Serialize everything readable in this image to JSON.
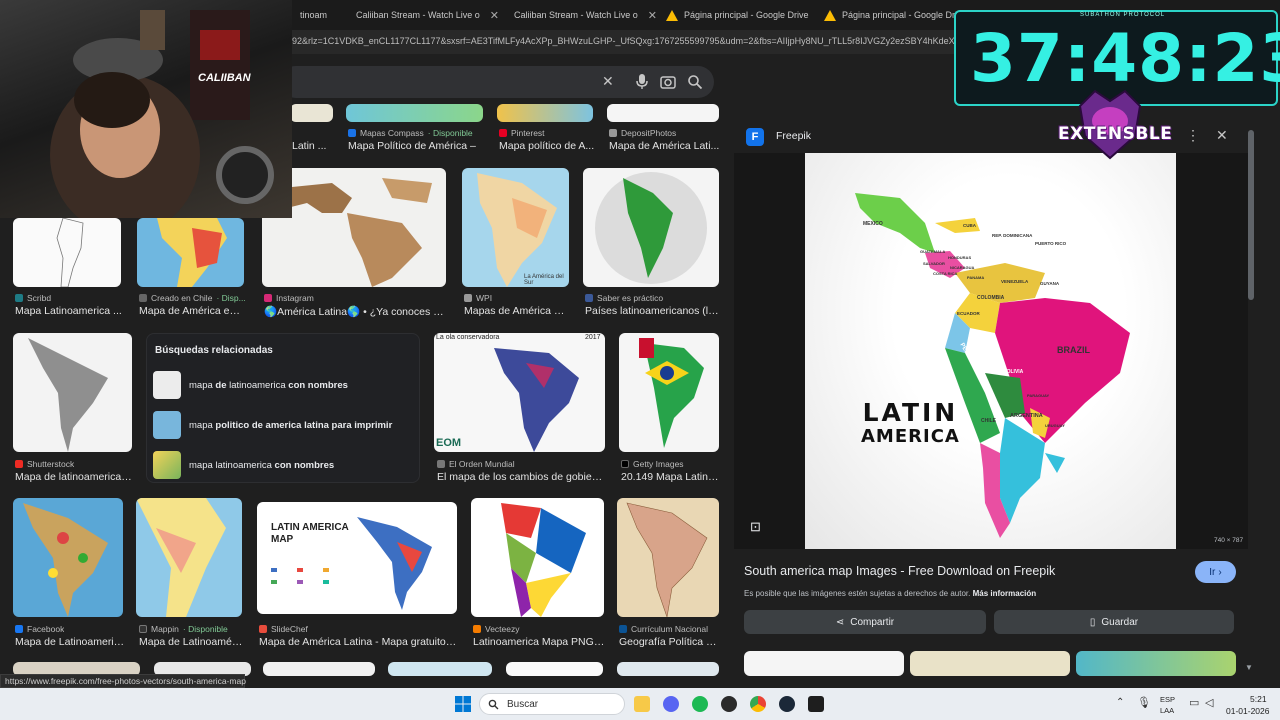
{
  "browser": {
    "tabs": [
      {
        "label": "tinoam",
        "type": "partial"
      },
      {
        "label": "Caliiban Stream - Watch Live o",
        "type": "kick"
      },
      {
        "label": "Caliiban Stream - Watch Live o",
        "type": "kick"
      },
      {
        "label": "Página principal - Google Drive",
        "type": "gdrive"
      },
      {
        "label": "Página principal - Google Drive",
        "type": "gdrive"
      }
    ],
    "url": "92&rlz=1C1VDKB_enCL1177CL1177&sxsrf=AE3TifMLFy4AcXPp_BHWzuLGHP-_UfSQxg:1767255599795&udm=2&fbs=AIIjpHy8NU_rTLL5r8IJVGZy2ezSBY4hKdeX"
  },
  "results": {
    "row1": [
      {
        "source": "Mapas Compass",
        "available": "· Disponible",
        "title": "Mapa Político de América –",
        "fav": "#1a73e8"
      },
      {
        "source": "Pinterest",
        "available": "",
        "title": "Mapa político de A...",
        "fav": "#e60023"
      },
      {
        "source": "DepositPhotos",
        "available": "",
        "title": "Mapa de América Lati...",
        "fav": "#222"
      },
      {
        "source": "",
        "available": "",
        "title": "Latin ...",
        "fav": "#555"
      }
    ],
    "row2": [
      {
        "source": "Scribd",
        "available": "",
        "title": "Mapa Latinoamerica ...",
        "fav": "#1e7b85"
      },
      {
        "source": "Creado en Chile",
        "available": "· Disp...",
        "title": "Mapa de América en ...",
        "fav": "#666"
      },
      {
        "source": "Instagram",
        "available": "",
        "title": "🌎América Latina🌎 • ¿Ya conoces nue...",
        "fav": "#d62976"
      },
      {
        "source": "WPI",
        "available": "",
        "title": "Mapas de América La...",
        "fav": "#999"
      },
      {
        "source": "Saber es práctico",
        "available": "",
        "title": "Países latinoamericanos (lis...",
        "fav": "#3b5998"
      }
    ],
    "row3": [
      {
        "source": "Shutterstock",
        "available": "",
        "title": "Mapa de latinoamerica: ...",
        "fav": "#ee2b24"
      },
      {
        "source": "El Orden Mundial",
        "available": "",
        "title": "El mapa de los cambios de gobierno...",
        "fav": "#777"
      },
      {
        "source": "Getty Images",
        "available": "",
        "title": "20.149 Mapa Latino...",
        "fav": "#000"
      }
    ],
    "row4": [
      {
        "source": "Facebook",
        "available": "",
        "title": "Mapa de Latinoameric...",
        "fav": "#1877f2"
      },
      {
        "source": "Mappin",
        "available": "· Disponible",
        "title": "Mapa de Latinoaméri...",
        "fav": "#333"
      },
      {
        "source": "SlideChef",
        "available": "",
        "title": "Mapa de América Latina - Mapa gratuito de ...",
        "fav": "#e74c3c"
      },
      {
        "source": "Vecteezy",
        "available": "",
        "title": "Latinoamerica Mapa PNG ...",
        "fav": "#f57c00"
      },
      {
        "source": "Currículum Nacional",
        "available": "",
        "title": "Geografía Política d...",
        "fav": "#0b5394"
      }
    ],
    "thumb_texts": {
      "ola": "La ola conservadora",
      "ola_year": "2017",
      "eom": "EOM",
      "latin_map_title": "LATIN AMERICA MAP",
      "sud": "La América del Sur"
    }
  },
  "related": {
    "header": "Búsquedas relacionadas",
    "items": [
      {
        "pre": "mapa ",
        "bold1": "de",
        "mid": " latinoamerica ",
        "bold2": "con nombres",
        "post": ""
      },
      {
        "pre": "mapa ",
        "bold1": "politico de america latina para imprimir",
        "mid": "",
        "bold2": "",
        "post": ""
      },
      {
        "pre": "mapa latinoamerica ",
        "bold1": "con nombres",
        "mid": "",
        "bold2": "",
        "post": ""
      }
    ]
  },
  "panel": {
    "site": "Freepik",
    "image_title": "LATIN AMERICA",
    "title_line1": "LATIN",
    "title_line2": "AMERICA",
    "dimensions": "740 × 787",
    "title": "South america map Images - Free Download on Freepik",
    "visit": "Ir",
    "copyright": "Es posible que las imágenes estén sujetas a derechos de autor.",
    "more_info": "Más información",
    "share": "Compartir",
    "save": "Guardar",
    "map_labels": {
      "mexico": "MEXICO",
      "cuba": "CUBA",
      "rep_dom": "REP. DOMINICANA",
      "puerto_rico": "PUERTO RICO",
      "guatemala": "GUATEMALA",
      "honduras": "HONDURAS",
      "salvador": "SALVADOR",
      "nicaragua": "NICARAGUA",
      "costa_rica": "COSTA RICA",
      "panama": "PANAMA",
      "venezuela": "VENEZUELA",
      "guyana": "GUYANA",
      "colombia": "COLOMBIA",
      "ecuador": "ECUADOR",
      "peru": "PERU",
      "brazil": "BRAZIL",
      "bolivia": "BOLIVIA",
      "paraguay": "PARAGUAY",
      "chile": "CHILE",
      "argentina": "ARGENTINA",
      "uruguay": "URUGUAY"
    }
  },
  "overlay": {
    "timer": "37:48:23",
    "timer_caption": "SUBATHON PROTOCOL",
    "badge": "EXTENSBLE",
    "webcam_sign": "CALIIBAN"
  },
  "statusbar": "https://www.freepik.com/free-photos-vectors/south-america-map",
  "taskbar": {
    "search_placeholder": "Buscar",
    "lang": "ESP",
    "lang2": "LAA",
    "time": "5:21",
    "date": "01-01-2026"
  },
  "colors": {
    "bg": "#1f1f1f",
    "accent_blue": "#8ab4f8",
    "timer": "#35f0e3",
    "visit_button": "#8ab4f8"
  }
}
